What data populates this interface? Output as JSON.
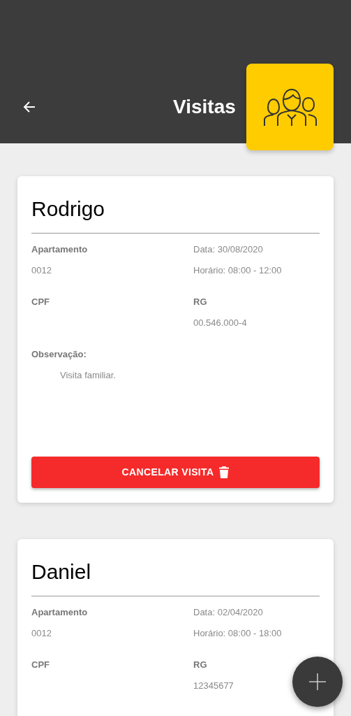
{
  "header": {
    "title": "Visitas"
  },
  "visits": [
    {
      "name": "Rodrigo",
      "apartment_label": "Apartamento",
      "apartment": "0012",
      "date": "Data: 30/08/2020",
      "time": "Horário: 08:00 - 12:00",
      "cpf_label": "CPF",
      "rg_label": "RG",
      "rg": "00.546.000-4",
      "observation_label": "Observação:",
      "observation": "Visita familiar.",
      "cancel_button": "CANCELAR VISITA"
    },
    {
      "name": "Daniel",
      "apartment_label": "Apartamento",
      "apartment": "0012",
      "date": "Data: 02/04/2020",
      "time": "Horário: 08:00 - 18:00",
      "cpf_label": "CPF",
      "rg_label": "RG",
      "rg": "12345677"
    }
  ]
}
